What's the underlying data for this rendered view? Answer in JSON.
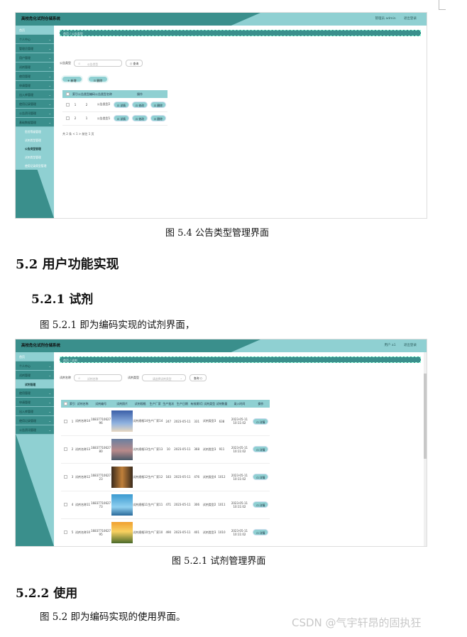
{
  "fig1": {
    "app_title": "高校危化试剂仓储系统",
    "user_text": "管理员 admin",
    "logout": "退出登录",
    "sidebar": [
      {
        "label": "首页",
        "light": true
      },
      {
        "label": "个人中心"
      },
      {
        "label": "管理员管理"
      },
      {
        "label": "用户管理"
      },
      {
        "label": "试剂管理"
      },
      {
        "label": "使用管理"
      },
      {
        "label": "申请管理"
      },
      {
        "label": "出入库管理"
      },
      {
        "label": "使用记录管理"
      },
      {
        "label": "公告资讯管理"
      },
      {
        "label": "基础数据管理"
      }
    ],
    "submenu": [
      "危险等级管理",
      "试剂类型管理",
      "公告类型管理",
      "试剂类型管理",
      "使用记录类型管理"
    ],
    "submenu_active_index": 2,
    "breadcrumb": "首页  / 公告类型",
    "search_label": "公告类型",
    "search_placeholder": "公告类型",
    "search_button": "查询",
    "add_button": "新增",
    "delete_button": "删除",
    "table_headers": [
      "",
      "索引",
      "公告类型编码",
      "公告类型名称",
      "操作"
    ],
    "rows": [
      {
        "index": "1",
        "code": "2",
        "name": "公告类型2"
      },
      {
        "index": "2",
        "code": "1",
        "name": "公告类型1"
      }
    ],
    "row_actions": [
      "详情",
      "修改",
      "删除"
    ],
    "pager": "共 2 条   <   1   >   前往   1   页"
  },
  "caption1": "图 5.4  公告类型管理界面",
  "heading_52": "5.2  用户功能实现",
  "heading_521": "5.2.1  试剂",
  "para_521": "图 5.2.1  即为编码实现的试剂界面，",
  "fig2": {
    "app_title": "高校危化试剂仓储系统",
    "user_text": "用户 a1",
    "logout": "退出登录",
    "sidebar_top": [
      "首页",
      "个人中心",
      "试剂管理"
    ],
    "submenu": [
      "试剂管理"
    ],
    "sidebar_bottom": [
      "使用管理",
      "申请管理",
      "出入库管理",
      "使用记录管理",
      "公告资讯管理"
    ],
    "breadcrumb": "首页  / 试剂",
    "search_label1": "试剂名称",
    "search_placeholder1": "试剂名称",
    "search_label2": "试剂类型",
    "search_placeholder2": "请选择试剂类型",
    "search_button": "查询",
    "table_headers": [
      "",
      "索引",
      "试剂名称",
      "试剂编号",
      "试剂照片",
      "试剂规格",
      "生产厂家",
      "生产批次",
      "生产日期",
      "有效期/月",
      "试剂类型",
      "试剂数量",
      "录入时间",
      "操作"
    ],
    "rows": [
      {
        "index": "1",
        "name": "试剂名称14",
        "code": "1683771062796",
        "spec": "试剂规格14",
        "maker": "生产厂家14",
        "batch": "247",
        "date": "2023-05-11",
        "valid": "331",
        "type": "试剂类型3",
        "qty": "638",
        "time": "2023-05-11 10:11:02"
      },
      {
        "index": "2",
        "name": "试剂名称13",
        "code": "1683771062780",
        "spec": "试剂规格13",
        "maker": "生产厂家13",
        "batch": "10",
        "date": "2023-05-11",
        "valid": "368",
        "type": "试剂类型3",
        "qty": "911",
        "time": "2023-05-11 10:11:02"
      },
      {
        "index": "3",
        "name": "试剂名称12",
        "code": "1683771062723",
        "spec": "试剂规格12",
        "maker": "生产厂家12",
        "batch": "183",
        "date": "2023-05-11",
        "valid": "476",
        "type": "试剂类型4",
        "qty": "1012",
        "time": "2023-05-11 10:11:02"
      },
      {
        "index": "4",
        "name": "试剂名称11",
        "code": "1683771062773",
        "spec": "试剂规格11",
        "maker": "生产厂家11",
        "batch": "471",
        "date": "2023-05-11",
        "valid": "306",
        "type": "试剂类型2",
        "qty": "1011",
        "time": "2023-05-11 10:11:02"
      },
      {
        "index": "5",
        "name": "试剂名称10",
        "code": "1683771062795",
        "spec": "试剂规格10",
        "maker": "生产厂家10",
        "batch": "490",
        "date": "2023-05-11",
        "valid": "401",
        "type": "试剂类型3",
        "qty": "1010",
        "time": "2023-05-11 10:11:02"
      }
    ],
    "row_action": "详情"
  },
  "caption2": "图 5.2.1  试剂管理界面",
  "heading_522": "5.2.2  使用",
  "para_522": "图 5.2  即为编码实现的使用界面。",
  "watermark": "CSDN @气宇轩昂的固执狂",
  "colors": {
    "teal_dark": "#3a8f8c",
    "teal_light": "#8fd0d2"
  }
}
